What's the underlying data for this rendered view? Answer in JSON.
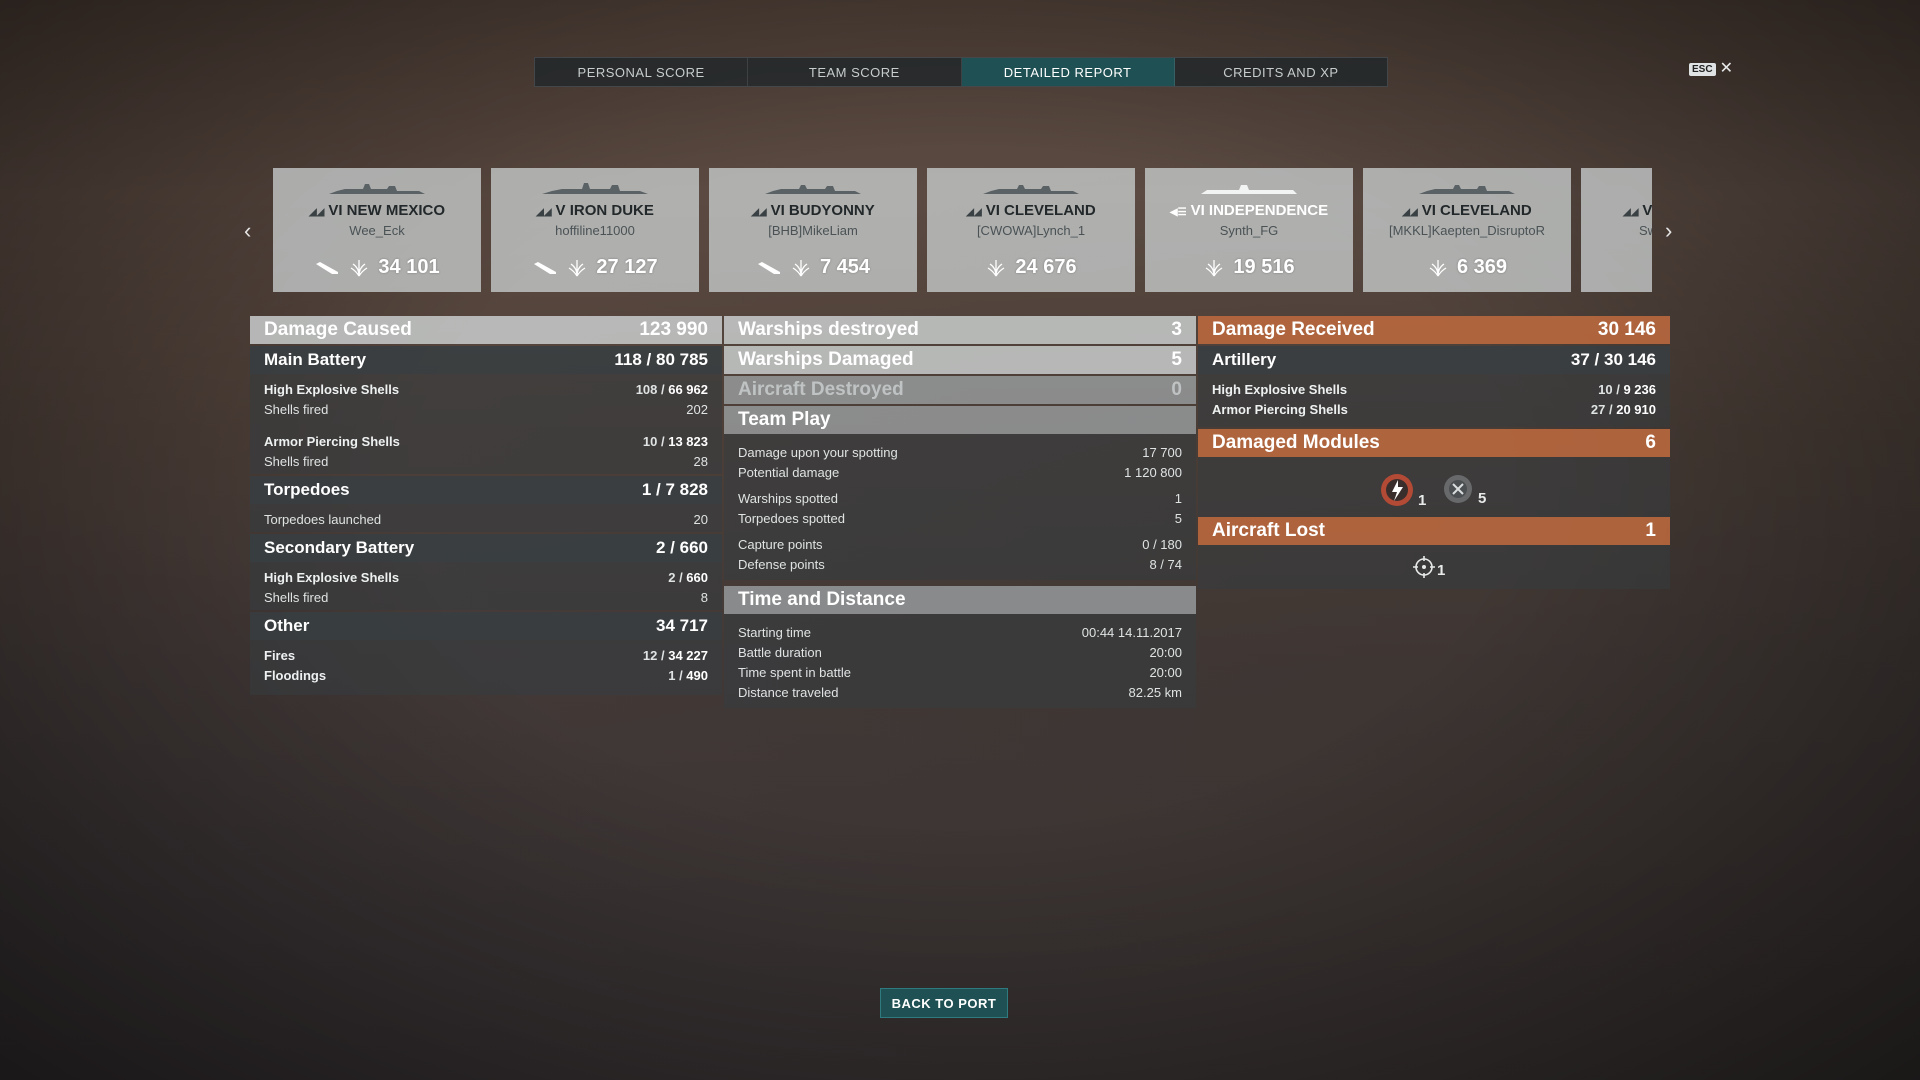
{
  "tabs": [
    {
      "label": "PERSONAL SCORE"
    },
    {
      "label": "TEAM SCORE"
    },
    {
      "label": "DETAILED REPORT"
    },
    {
      "label": "CREDITS AND XP"
    }
  ],
  "esc": {
    "key": "ESC",
    "close": "✕"
  },
  "ships": [
    {
      "name": "VI NEW MEXICO",
      "player": "Wee_Eck",
      "score": "34 101"
    },
    {
      "name": "V IRON DUKE",
      "player": "hoffiline11000",
      "score": "27 127"
    },
    {
      "name": "VI BUDYONNY",
      "player": "[BHB]MikeLiam",
      "score": "7 454"
    },
    {
      "name": "VI CLEVELAND",
      "player": "[CWOWA]Lynch_1",
      "score": "24 676"
    },
    {
      "name": "VI INDEPENDENCE",
      "player": "Synth_FG",
      "score": "19 516"
    },
    {
      "name": "VI CLEVELAND",
      "player": "[MKKL]Kaepten_DisruptoR",
      "score": "6 369"
    },
    {
      "name": "V",
      "player": "Sw",
      "score": ""
    }
  ],
  "damage": {
    "title": "Damage Caused",
    "total": "123 990",
    "main_battery": {
      "label": "Main Battery",
      "hits": "118",
      "dmg": "80 785",
      "he_label": "High Explosive Shells",
      "he_hits": "108",
      "he_dmg": "66 962",
      "he_fired_label": "Shells fired",
      "he_fired": "202",
      "ap_label": "Armor Piercing Shells",
      "ap_hits": "10",
      "ap_dmg": "13 823",
      "ap_fired_label": "Shells fired",
      "ap_fired": "28"
    },
    "torpedoes": {
      "label": "Torpedoes",
      "hits": "1",
      "dmg": "7 828",
      "launched_label": "Torpedoes launched",
      "launched": "20"
    },
    "secondary": {
      "label": "Secondary Battery",
      "hits": "2",
      "dmg": "660",
      "he_label": "High Explosive Shells",
      "he_hits": "2",
      "he_dmg": "660",
      "fired_label": "Shells fired",
      "fired": "8"
    },
    "other": {
      "label": "Other",
      "total": "34 717",
      "fires_label": "Fires",
      "fires_count": "12",
      "fires_dmg": "34 227",
      "flood_label": "Floodings",
      "flood_count": "1",
      "flood_dmg": "490"
    }
  },
  "middle": {
    "destroyed_label": "Warships destroyed",
    "destroyed": "3",
    "damaged_label": "Warships Damaged",
    "damaged": "5",
    "aircraft_label": "Aircraft Destroyed",
    "aircraft": "0",
    "team_play": {
      "title": "Team Play",
      "spot_dmg_label": "Damage upon your spotting",
      "spot_dmg": "17 700",
      "potential_label": "Potential damage",
      "potential": "1 120 800",
      "ws_spotted_label": "Warships spotted",
      "ws_spotted": "1",
      "torp_spotted_label": "Torpedoes spotted",
      "torp_spotted": "5",
      "capture_label": "Capture points",
      "capture": "0 / 180",
      "defense_label": "Defense points",
      "defense": "8 / 74"
    },
    "time": {
      "title": "Time and Distance",
      "start_label": "Starting time",
      "start": "00:44  14.11.2017",
      "duration_label": "Battle duration",
      "duration": "20:00",
      "spent_label": "Time spent in battle",
      "spent": "20:00",
      "distance_label": "Distance traveled",
      "distance": "82.25 km"
    }
  },
  "received": {
    "title": "Damage Received",
    "total": "30 146",
    "artillery": {
      "label": "Artillery",
      "hits": "37",
      "dmg": "30 146",
      "he_label": "High Explosive Shells",
      "he_hits": "10",
      "he_dmg": "9 236",
      "ap_label": "Armor Piercing Shells",
      "ap_hits": "27",
      "ap_dmg": "20 910"
    },
    "modules": {
      "title": "Damaged Modules",
      "total": "6",
      "m1": "1",
      "m2": "5"
    },
    "aircraft_lost": {
      "title": "Aircraft Lost",
      "total": "1",
      "count": "1"
    }
  },
  "back_button": "BACK TO PORT",
  "colors": {
    "accent_teal": "#1f5053",
    "orange": "#b9683e"
  }
}
